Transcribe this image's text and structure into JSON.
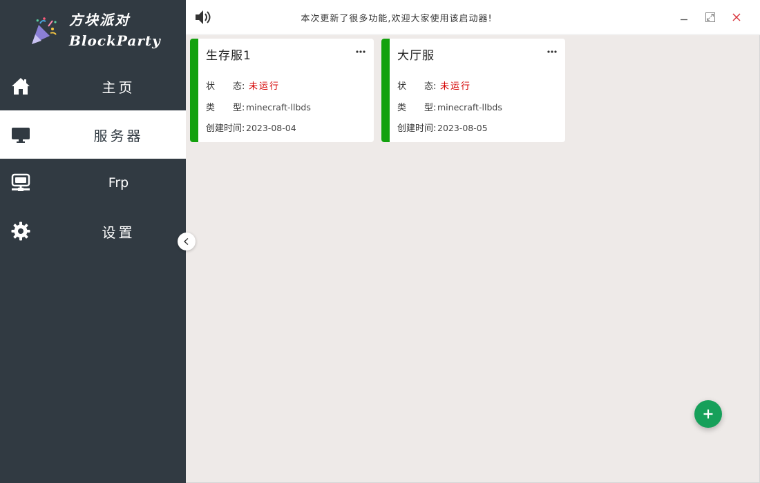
{
  "app": {
    "logo_line1": "方块派对",
    "logo_line2": "BlockParty"
  },
  "sidebar": {
    "items": [
      {
        "label": "主页",
        "icon": "home-icon",
        "active": false
      },
      {
        "label": "服务器",
        "icon": "monitor-icon",
        "active": true
      },
      {
        "label": "Frp",
        "icon": "network-monitor-icon",
        "active": false
      },
      {
        "label": "设置",
        "icon": "gear-icon",
        "active": false
      }
    ]
  },
  "header": {
    "notice": "本次更新了很多功能,欢迎大家使用该启动器!"
  },
  "servers": [
    {
      "name": "生存服1",
      "status_label": "状　　态:",
      "status_value": "未运行",
      "type_label": "类　　型:",
      "type_value": "minecraft-llbds",
      "created_label": "创建时间:",
      "created_value": "2023-08-04"
    },
    {
      "name": "大厅服",
      "status_label": "状　　态:",
      "status_value": "未运行",
      "type_label": "类　　型:",
      "type_value": "minecraft-llbds",
      "created_label": "创建时间:",
      "created_value": "2023-08-05"
    }
  ],
  "colors": {
    "sidebar_bg": "#313a42",
    "accent_green": "#13a10e",
    "status_stopped": "#d40000",
    "fab_green": "#16a05a",
    "content_bg": "#eeeae8"
  }
}
